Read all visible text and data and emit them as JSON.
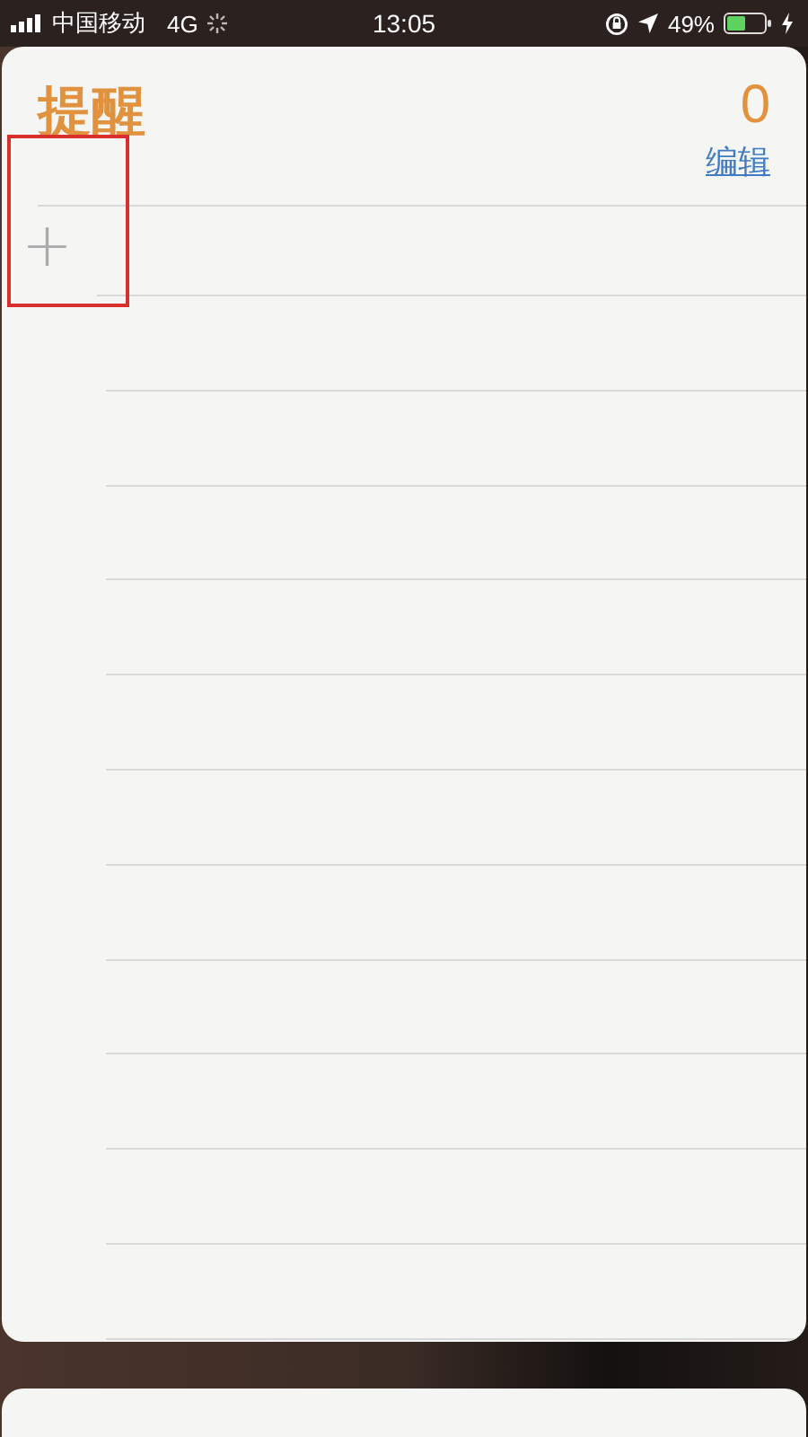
{
  "status_bar": {
    "carrier": "中国移动",
    "network": "4G",
    "time": "13:05",
    "battery": "49%"
  },
  "list": {
    "title": "提醒",
    "count": "0",
    "edit": "编辑",
    "add": "+"
  }
}
